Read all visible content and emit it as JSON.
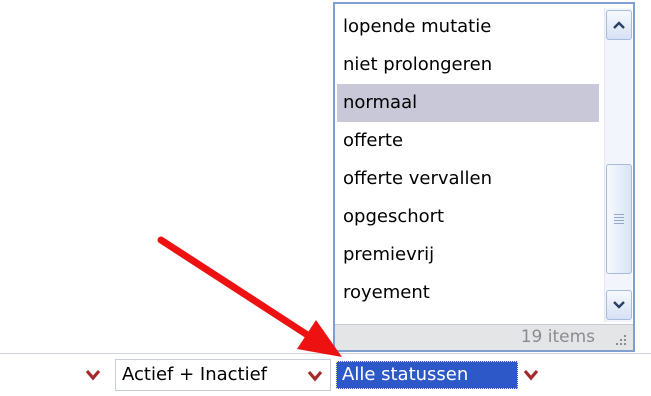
{
  "dropdown": {
    "items": [
      {
        "label": "lopende mutatie"
      },
      {
        "label": "niet prolongeren"
      },
      {
        "label": "normaal"
      },
      {
        "label": "offerte"
      },
      {
        "label": "offerte vervallen"
      },
      {
        "label": "opgeschort"
      },
      {
        "label": "premievrij"
      },
      {
        "label": "royement"
      }
    ],
    "selected_index": 2,
    "item_count": "19 items",
    "scroll_position": 0.62
  },
  "filters": {
    "left_value": "",
    "active_filter": "Actief + Inactief",
    "status_filter": "Alle statussen"
  },
  "colors": {
    "selection_highlight": "#c9c8d8",
    "focused_selection": "#2d58c8",
    "chevron": "#a52a2a",
    "arrow": "#ee1111",
    "popup_border": "#7e9fd0"
  },
  "icons": {
    "scroll_up": "chevron-up-icon",
    "scroll_down": "chevron-down-icon",
    "dropdown": "chevron-down-icon",
    "resize": "resize-grip-icon",
    "pointer": "red-arrow-icon"
  }
}
